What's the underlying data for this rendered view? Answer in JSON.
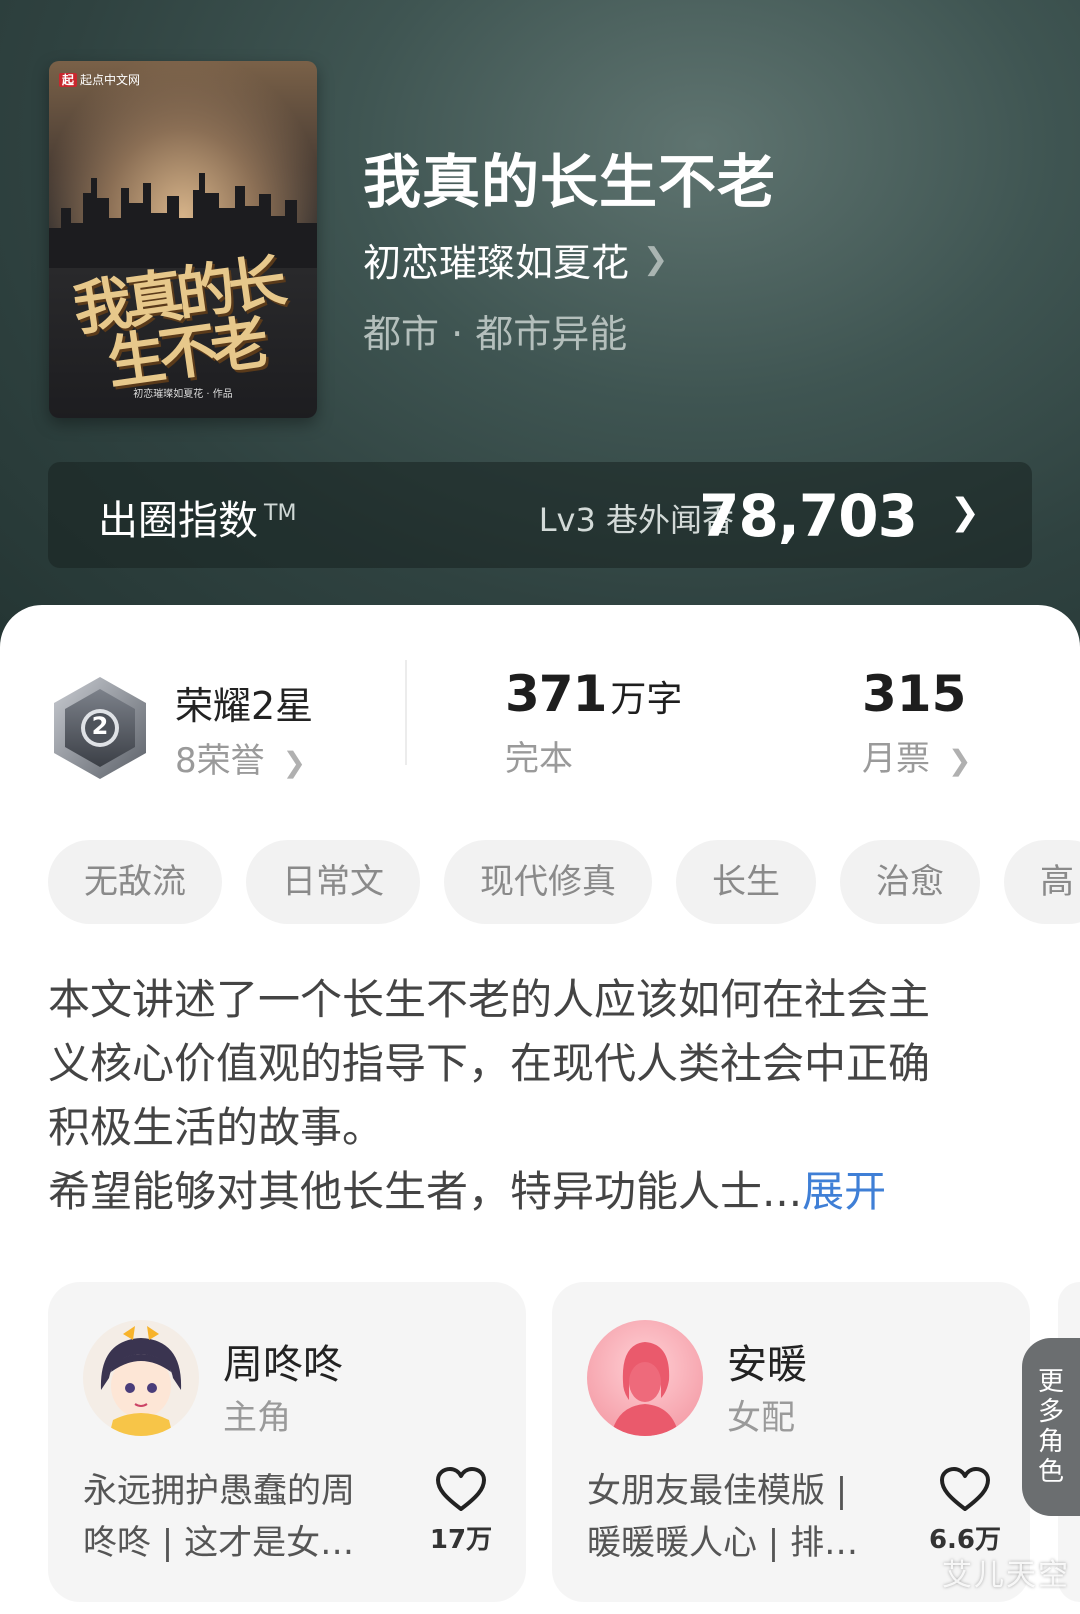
{
  "book": {
    "cover_brand": "起点中文网",
    "cover_title": "我真的长生不老",
    "cover_author": "初恋璀璨如夏花 · 作品",
    "title": "我真的长生不老",
    "author": "初恋璀璨如夏花",
    "genre": "都市 · 都市异能"
  },
  "index": {
    "label": "出圈指数",
    "tm": "TM",
    "level": "Lv3 巷外闻香",
    "value": "78,703"
  },
  "stats": {
    "honor_title": "荣耀2星",
    "honor_sub": "8荣誉",
    "badge_number": "2",
    "words_num": "371",
    "words_unit": "万字",
    "words_status": "完本",
    "votes_num": "315",
    "votes_label": "月票"
  },
  "tags": [
    "无敌流",
    "日常文",
    "现代修真",
    "长生",
    "治愈",
    "高"
  ],
  "description": {
    "line1": "本文讲述了一个长生不老的人应该如何在社会主",
    "line2": "义核心价值观的指导下，在现代人类社会中正确",
    "line3": "积极生活的故事。",
    "line4": "希望能够对其他长生者，特异功能人士...",
    "expand": "展开"
  },
  "characters": [
    {
      "name": "周咚咚",
      "role": "主角",
      "quote": "永远拥护愚蠢的周咚咚 | 这才是女…",
      "likes": "17万"
    },
    {
      "name": "安暖",
      "role": "女配",
      "quote": "女朋友最佳模版 | 暖暖暖人心 | 排…",
      "likes": "6.6万"
    }
  ],
  "more_roles": "更多角色",
  "watermark": "艾儿天空",
  "colors": {
    "accent_link": "#3f7fd6",
    "hero_bg": "#2f4240"
  }
}
